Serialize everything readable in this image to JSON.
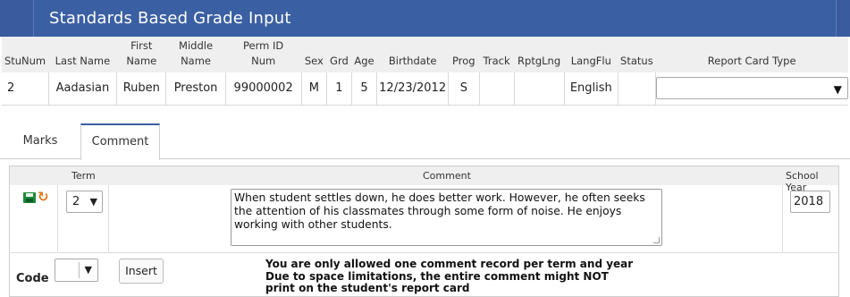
{
  "app": {
    "title": "Standards Based Grade Input"
  },
  "student_table": {
    "headers": [
      "StuNum",
      "Last Name",
      "First\nName",
      "Middle\nName",
      "Perm ID\nNum",
      "Sex",
      "Grd",
      "Age",
      "Birthdate",
      "Prog",
      "Track",
      "RptgLng",
      "LangFlu",
      "Status",
      "Report Card Type"
    ],
    "row": {
      "stunum": "2",
      "last_name": "Aadasian",
      "first_name": "Ruben",
      "middle_name": "Preston",
      "perm_id": "99000002",
      "sex": "M",
      "grd": "1",
      "age": "5",
      "birthdate": "12/23/2012",
      "prog": "S",
      "track": "",
      "rptglng": "",
      "langflu": "English",
      "status": "",
      "report_card_type": ""
    }
  },
  "tabs": [
    {
      "label": "Marks",
      "active": false
    },
    {
      "label": "Comment",
      "active": true
    }
  ],
  "comment_panel": {
    "headers": {
      "term": "Term",
      "comment": "Comment",
      "school_year": "School Year"
    },
    "row": {
      "term": "2",
      "comment": "When student settles down, he does better work.  However, he often seeks the attention of his classmates through some form of noise.  He enjoys working with other students.",
      "school_year": "2018"
    },
    "icons": {
      "save": "save-icon",
      "undo": "undo-icon"
    },
    "code_label": "Code",
    "code_value": "",
    "insert_label": "Insert",
    "notice": [
      "You are only allowed one comment record per term and year",
      "Due to space limitations, the entire comment might NOT",
      "print on the student's report card"
    ]
  },
  "colors": {
    "titlebar": "#3b5fa3",
    "accent_orange": "#e07a1f",
    "save_green": "#1e8a3a"
  }
}
